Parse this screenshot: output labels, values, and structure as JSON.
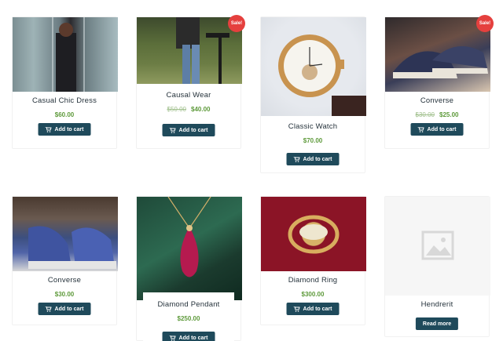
{
  "colors": {
    "button": "#1f4a5b",
    "price": "#5e9a3b",
    "sale": "#e5403e"
  },
  "badges": {
    "sale": "Sale!"
  },
  "products": [
    {
      "name": "Casual Chic Dress",
      "price": "$60.00",
      "old_price": "",
      "button": "Add to cart",
      "sale": false,
      "image": "woman-in-black-dress"
    },
    {
      "name": "Causal Wear",
      "price": "$40.00",
      "old_price": "$50.00",
      "button": "Add to cart",
      "sale": true,
      "image": "jeans-and-shirt"
    },
    {
      "name": "Classic Watch",
      "price": "$70.00",
      "old_price": "",
      "button": "Add to cart",
      "sale": false,
      "image": "gold-wrist-watch"
    },
    {
      "name": "Converse",
      "price": "$25.00",
      "old_price": "$30.00",
      "button": "Add to cart",
      "sale": true,
      "image": "navy-sneakers"
    },
    {
      "name": "Converse",
      "price": "$30.00",
      "old_price": "",
      "button": "Add to cart",
      "sale": false,
      "image": "blue-sneakers-on-feet"
    },
    {
      "name": "Diamond Pendant",
      "price": "$250.00",
      "old_price": "",
      "button": "Add to cart",
      "sale": false,
      "image": "ruby-pendant"
    },
    {
      "name": "Diamond Ring",
      "price": "$300.00",
      "old_price": "",
      "button": "Add to cart",
      "sale": false,
      "image": "diamond-ring"
    },
    {
      "name": "Hendrerit",
      "price": "",
      "old_price": "",
      "button": "Read more",
      "sale": false,
      "image": "placeholder-image-icon"
    }
  ]
}
